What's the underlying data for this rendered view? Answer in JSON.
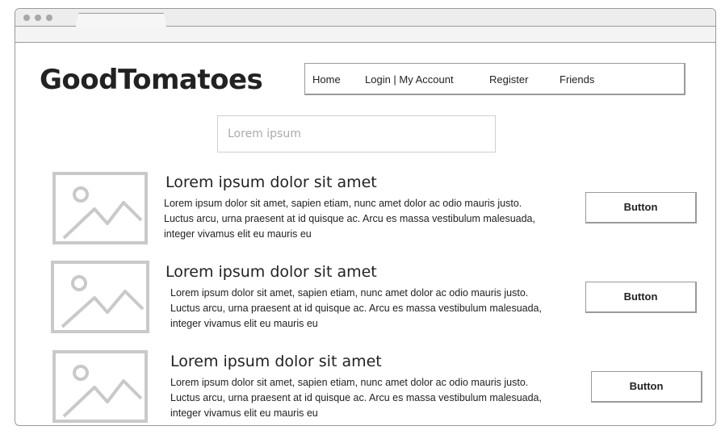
{
  "site": {
    "logo": "GoodTomatoes"
  },
  "nav": {
    "items": [
      {
        "label": "Home"
      },
      {
        "label": "Login | My Account"
      },
      {
        "label": "Register"
      },
      {
        "label": "Friends"
      }
    ]
  },
  "search": {
    "placeholder": "Lorem ipsum"
  },
  "results": [
    {
      "title": "Lorem ipsum dolor sit amet",
      "line1": "Lorem ipsum dolor sit amet, sapien etiam, nunc amet dolor ac odio mauris justo.",
      "line2": "Luctus arcu, urna praesent at id quisque ac. Arcu es massa vestibulum malesuada,",
      "line3": "integer vivamus elit eu mauris eu",
      "button": "Button"
    },
    {
      "title": "Lorem ipsum dolor sit amet",
      "line1": "Lorem ipsum dolor sit amet, sapien etiam, nunc amet dolor ac odio mauris justo.",
      "line2": "Luctus arcu, urna praesent at id quisque ac. Arcu es massa vestibulum malesuada,",
      "line3": "integer vivamus elit eu mauris eu",
      "button": "Button"
    },
    {
      "title": "Lorem ipsum dolor sit amet",
      "line1": "Lorem ipsum dolor sit amet, sapien etiam, nunc amet dolor ac odio mauris justo.",
      "line2": "Luctus arcu, urna praesent at id quisque ac. Arcu es massa vestibulum malesuada,",
      "line3": "integer vivamus elit eu mauris eu",
      "button": "Button"
    }
  ],
  "icons": {
    "thumbnail": "image-placeholder-icon"
  },
  "colors": {
    "sketch_border": "#9a9a9a",
    "placeholder_gray": "#c9c9c9"
  }
}
